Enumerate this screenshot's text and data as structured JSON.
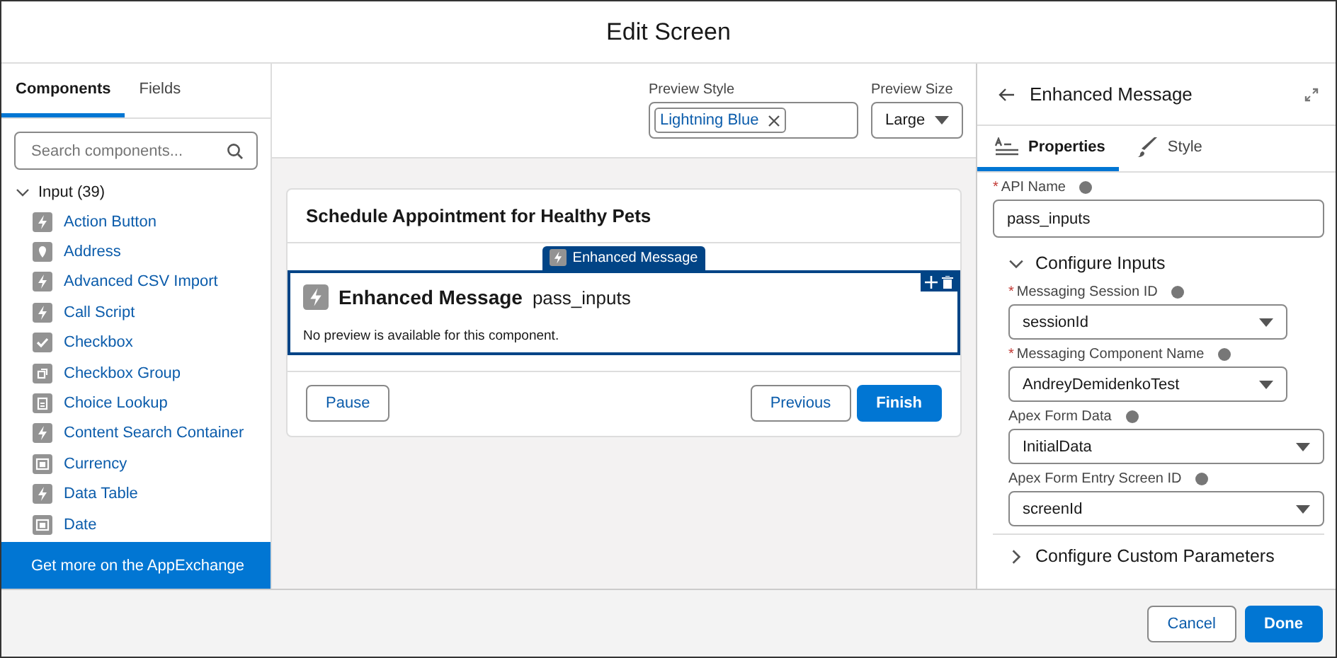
{
  "window": {
    "title": "Edit Screen"
  },
  "sidebar": {
    "tabs": [
      {
        "label": "Components",
        "selected": true
      },
      {
        "label": "Fields",
        "selected": false
      }
    ],
    "search": {
      "placeholder": "Search components..."
    },
    "group": {
      "label": "Input (39)",
      "expanded": true,
      "items": [
        {
          "label": "Action Button",
          "kind": "bolt"
        },
        {
          "label": "Address",
          "kind": "pin"
        },
        {
          "label": "Advanced CSV Import",
          "kind": "bolt"
        },
        {
          "label": "Call Script",
          "kind": "bolt"
        },
        {
          "label": "Checkbox",
          "kind": "check"
        },
        {
          "label": "Checkbox Group",
          "kind": "group"
        },
        {
          "label": "Choice Lookup",
          "kind": "lookup"
        },
        {
          "label": "Content Search Container",
          "kind": "bolt"
        },
        {
          "label": "Currency",
          "kind": "currency"
        },
        {
          "label": "Data Table",
          "kind": "bolt"
        },
        {
          "label": "Date",
          "kind": "currency"
        }
      ]
    },
    "footer_link": "Get more on the AppExchange"
  },
  "preview": {
    "style_label": "Preview Style",
    "style_pill": "Lightning Blue",
    "size_label": "Preview Size",
    "size_value": "Large"
  },
  "canvas": {
    "title": "Schedule Appointment for Healthy Pets",
    "component_tag": "Enhanced Message",
    "component_type": "Enhanced Message",
    "component_name": "pass_inputs",
    "component_note": "No preview is available for this component.",
    "left_buttons": [
      "Pause"
    ],
    "right_buttons": [
      {
        "label": "Previous",
        "kind": "neutral"
      },
      {
        "label": "Finish",
        "kind": "brand"
      }
    ]
  },
  "properties": {
    "title": "Enhanced Message",
    "tabs": [
      {
        "label": "Properties",
        "selected": true
      },
      {
        "label": "Style",
        "selected": false
      }
    ],
    "api_name": {
      "label": "API Name",
      "required_mark": "*",
      "value": "pass_inputs"
    },
    "sections": [
      {
        "title": "Configure Inputs",
        "expanded": true,
        "fields": [
          {
            "label": "Messaging Session ID",
            "required_mark": "*",
            "value": "sessionId"
          },
          {
            "label": "Messaging Component Name",
            "required_mark": "*",
            "value": "AndreyDemidenkoTest"
          },
          {
            "label": "Apex Form Data",
            "value": "InitialData"
          },
          {
            "label": "Apex Form Entry Screen ID",
            "value": "screenId"
          }
        ]
      },
      {
        "title": "Configure Custom Parameters",
        "expanded": false
      }
    ]
  },
  "buttons": [
    {
      "label": "Cancel",
      "kind": "neutral"
    },
    {
      "label": "Done",
      "kind": "brand"
    }
  ]
}
